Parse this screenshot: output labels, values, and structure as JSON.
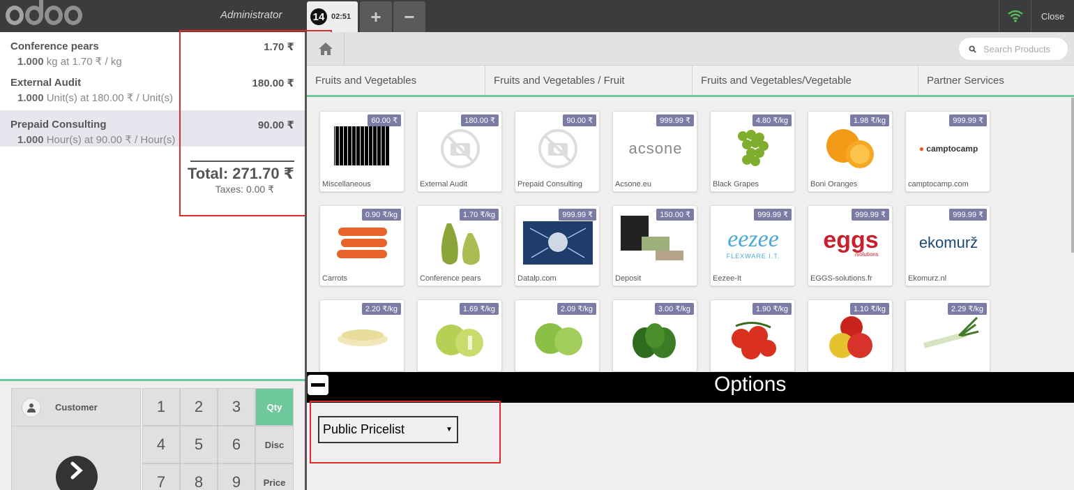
{
  "topbar": {
    "user": "Administrator",
    "order_number": "14",
    "order_time": "02:51",
    "add_order": "+",
    "remove_order": "−",
    "close": "Close"
  },
  "order": {
    "lines": [
      {
        "name": "Conference pears",
        "price": "1.70 ₹",
        "qty": "1.000",
        "info": "kg at 1.70 ₹ / kg"
      },
      {
        "name": "External Audit",
        "price": "180.00 ₹",
        "qty": "1.000",
        "info": "Unit(s) at 180.00 ₹ / Unit(s)"
      },
      {
        "name": "Prepaid Consulting",
        "price": "90.00 ₹",
        "qty": "1.000",
        "info": "Hour(s) at 90.00 ₹ / Hour(s)"
      }
    ],
    "total": "Total: 271.70 ₹",
    "taxes": "Taxes: 0.00 ₹"
  },
  "pad": {
    "customer": "Customer",
    "keys": [
      "1",
      "2",
      "3",
      "4",
      "5",
      "6",
      "7",
      "8",
      "9"
    ],
    "modes": [
      "Qty",
      "Disc",
      "Price"
    ]
  },
  "products_panel": {
    "search_placeholder": "Search Products",
    "categories": [
      "Fruits and Vegetables",
      "Fruits and Vegetables / Fruit",
      "Fruits and Vegetables/Vegetable",
      "Partner Services"
    ],
    "products": [
      {
        "name": "Miscellaneous",
        "price": "60.00 ₹"
      },
      {
        "name": "External Audit",
        "price": "180.00 ₹"
      },
      {
        "name": "Prepaid Consulting",
        "price": "90.00 ₹"
      },
      {
        "name": "Acsone.eu",
        "price": "999.99 ₹",
        "logo": "acsone"
      },
      {
        "name": "Black Grapes",
        "price": "4.80 ₹/kg"
      },
      {
        "name": "Boni Oranges",
        "price": "1.98 ₹/kg"
      },
      {
        "name": "camptocamp.com",
        "price": "999.99 ₹",
        "logo": "camptocamp"
      },
      {
        "name": "Carrots",
        "price": "0.90 ₹/kg"
      },
      {
        "name": "Conference pears",
        "price": "1.70 ₹/kg"
      },
      {
        "name": "Datalp.com",
        "price": "999.99 ₹"
      },
      {
        "name": "Deposit",
        "price": "150.00 ₹"
      },
      {
        "name": "Eezee-It",
        "price": "999.99 ₹",
        "logo": "eezee",
        "logo_sub": "FLEXWARE I.T."
      },
      {
        "name": "EGGS-solutions.fr",
        "price": "999.99 ₹",
        "logo": "eggs",
        "logo_sub": "/solutions"
      },
      {
        "name": "Ekomurz.nl",
        "price": "999.99 ₹",
        "logo": "ekomurž"
      },
      {
        "name": "",
        "price": "2.20 ₹/kg"
      },
      {
        "name": "",
        "price": "1.69 ₹/kg"
      },
      {
        "name": "",
        "price": "2.09 ₹/kg"
      },
      {
        "name": "",
        "price": "3.00 ₹/kg"
      },
      {
        "name": "",
        "price": "1.90 ₹/kg"
      },
      {
        "name": "",
        "price": "1.10 ₹/kg"
      },
      {
        "name": "",
        "price": "2.29 ₹/kg"
      }
    ]
  },
  "options": {
    "title": "Options",
    "pricelist": "Public Pricelist"
  },
  "colors": {
    "accent": "#6ec89b",
    "topbar": "#3c3c3c",
    "price_tag": "#7b7ba5",
    "highlight": "#e02b2b"
  }
}
